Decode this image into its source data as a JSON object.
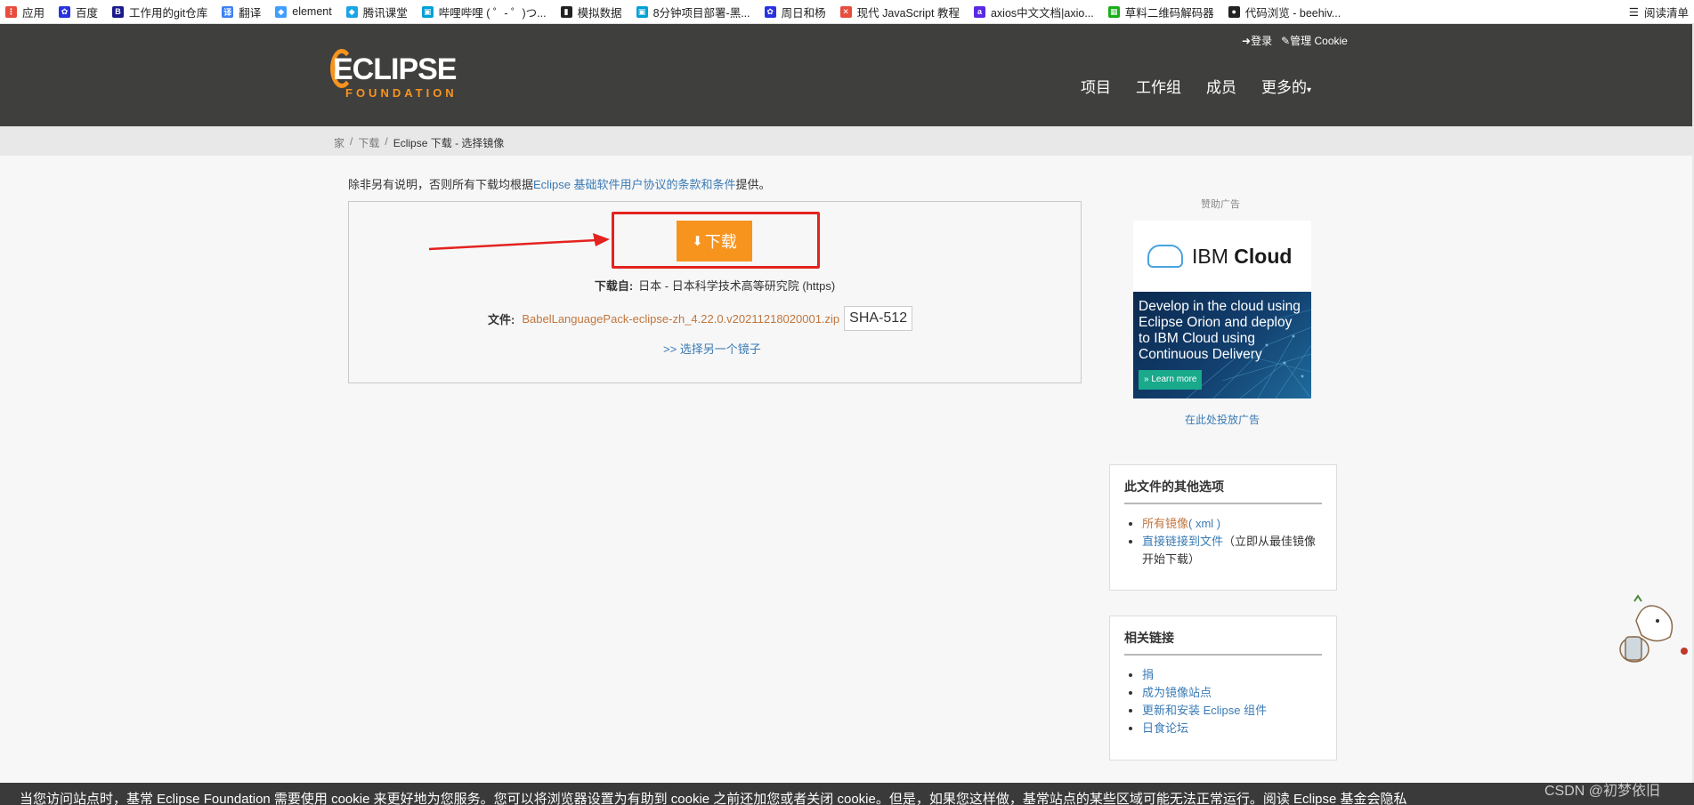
{
  "bookmarks": [
    {
      "label": "应用",
      "icon": "apps-grid-icon",
      "color": "#e84c3d"
    },
    {
      "label": "百度",
      "icon": "baidu-paw-icon",
      "color": "#2932e1"
    },
    {
      "label": "工作用的git仓库",
      "icon": "b-logo-icon",
      "color": "#1a1a8c"
    },
    {
      "label": "翻译",
      "icon": "translate-icon",
      "color": "#3b82f6"
    },
    {
      "label": "element",
      "icon": "element-logo-icon",
      "color": "#409eff"
    },
    {
      "label": "腾讯课堂",
      "icon": "tencent-class-icon",
      "color": "#1aa6e4"
    },
    {
      "label": "哔哩哔哩 ( ゜- ゜)つ...",
      "icon": "bilibili-icon",
      "color": "#00a1d6"
    },
    {
      "label": "模拟数据",
      "icon": "terminal-icon",
      "color": "#222222"
    },
    {
      "label": "8分钟项目部署-黑...",
      "icon": "bilibili-icon",
      "color": "#00a1d6"
    },
    {
      "label": "周日和杨",
      "icon": "baidu-paw-icon",
      "color": "#2932e1"
    },
    {
      "label": "现代 JavaScript 教程",
      "icon": "js-tutorial-icon",
      "color": "#e74c3c"
    },
    {
      "label": "axios中文文档|axio...",
      "icon": "axios-icon",
      "color": "#5a29e4"
    },
    {
      "label": "草料二维码解码器",
      "icon": "qr-icon",
      "color": "#1aad19"
    },
    {
      "label": "代码浏览 - beehiv...",
      "icon": "github-icon",
      "color": "#222222"
    }
  ],
  "bookmarks_right": {
    "label": "阅读清单",
    "icon": "reading-list-icon"
  },
  "header": {
    "login": "登录",
    "cookie": "管理 Cookie",
    "logo_main": "ECLIPSE",
    "logo_sub": "FOUNDATION",
    "nav": [
      "项目",
      "工作组",
      "成员",
      "更多的"
    ]
  },
  "breadcrumb": {
    "home": "家",
    "sep": "/",
    "downloads": "下载",
    "current": "Eclipse 下载 - 选择镜像"
  },
  "notice": {
    "prefix": "除非另有说明，否则所有下载均根据",
    "link": "Eclipse 基础软件用户协议的条款和条件",
    "suffix": "提供。"
  },
  "download": {
    "button": "下载",
    "from_label": "下载自:",
    "from_value": "日本 - 日本科学技术高等研究院 (https)",
    "file_label": "文件:",
    "file_name": "BabelLanguagePack-eclipse-zh_4.22.0.v20211218020001.zip",
    "sha_button": "SHA-512",
    "mirror_link": ">> 选择另一个镜子"
  },
  "sidebar": {
    "sponsor_label": "赞助广告",
    "ad": {
      "brand_prefix": "IBM",
      "brand_suffix": "Cloud",
      "text": "Develop in the cloud using Eclipse Orion and deploy to IBM Cloud using Continuous Delivery",
      "cta": "Learn more"
    },
    "ad_link": "在此处投放广告",
    "options": {
      "title": "此文件的其他选项",
      "item1_link": "所有镜像",
      "item1_xml": "( xml )",
      "item2_link": "直接链接到文件",
      "item2_note": "（立即从最佳镜像开始下载）"
    },
    "related": {
      "title": "相关链接",
      "items": [
        "捐",
        "成为镜像站点",
        "更新和安装 Eclipse 组件",
        "日食论坛"
      ]
    }
  },
  "cookie_bar": {
    "text": "当您访问站点时，基常 Eclipse Foundation 需要使用 cookie 来更好地为您服务。您可以将浏览器设置为有助到 cookie 之前还加您或者关闭 cookie。但是，如果您这样做，基常站点的某些区域可能无法正常运行。阅读 Eclipse 基金会隐私"
  },
  "watermark": "CSDN @初梦依旧",
  "colors": {
    "accent": "#f7941e",
    "header_bg": "#3f3f3e",
    "link": "#3a7bb5",
    "annotation_red": "#e3231f"
  }
}
